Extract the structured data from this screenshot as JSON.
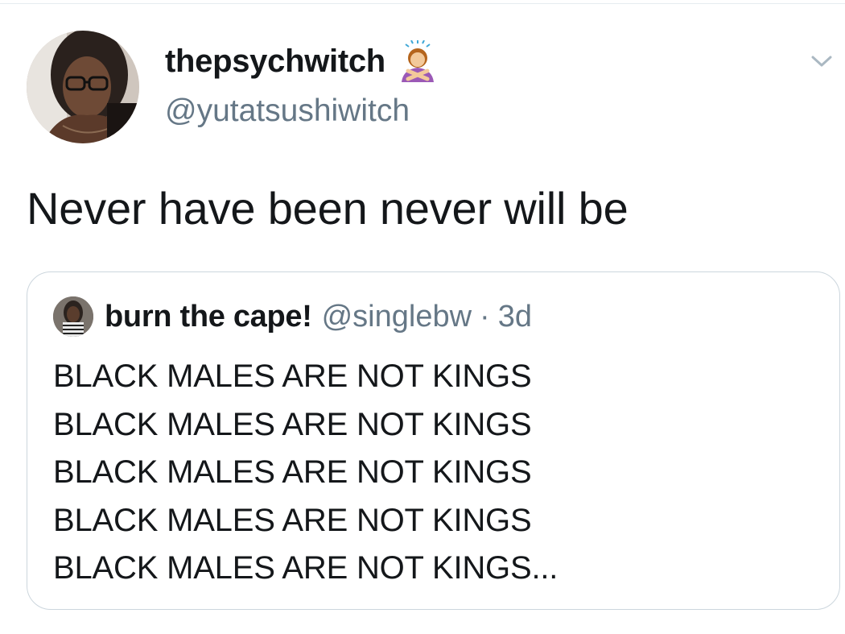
{
  "tweet": {
    "author": {
      "display_name": "thepsychwitch",
      "name_emoji": "person-gesturing-no-emoji",
      "handle": "@yutatsushiwitch",
      "avatar": "profile-photo"
    },
    "menu_icon": "chevron-down-icon",
    "text": "Never have been never will be",
    "quoted_tweet": {
      "display_name": "burn the cape!",
      "handle": "@singlebw",
      "separator": "·",
      "time": "3d",
      "lines": [
        "BLACK MALES ARE NOT KINGS",
        "BLACK MALES ARE NOT KINGS",
        "BLACK MALES ARE NOT KINGS",
        "BLACK MALES ARE NOT KINGS",
        "BLACK MALES ARE NOT KINGS..."
      ]
    }
  },
  "colors": {
    "text_primary": "#14171a",
    "text_secondary": "#657786",
    "border": "#ccd6dd",
    "background": "#ffffff"
  }
}
